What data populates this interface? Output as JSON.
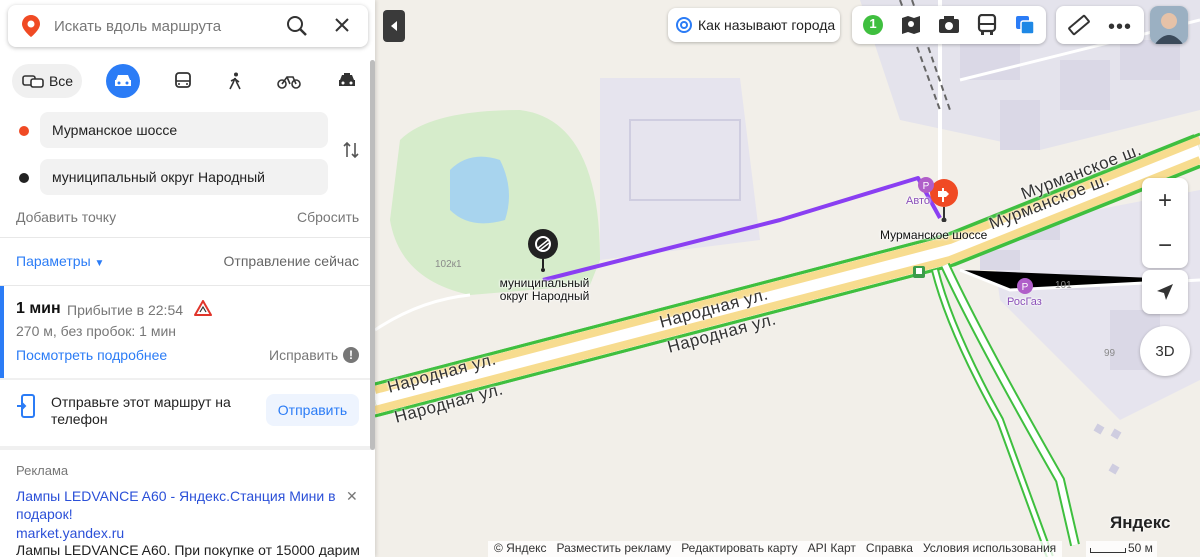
{
  "search": {
    "placeholder": "Искать вдоль маршрута"
  },
  "modes": {
    "all_label": "Все"
  },
  "route": {
    "from": "Мурманское шоссе",
    "to": "муниципальный округ Народный",
    "add_point": "Добавить точку",
    "reset": "Сбросить"
  },
  "params": {
    "label": "Параметры",
    "departure": "Отправление сейчас"
  },
  "route_card": {
    "time": "1 мин",
    "arrival": "Прибытие в 22:54",
    "distance": "270 м, без пробок: 1 мин",
    "details_link": "Посмотреть подробнее",
    "fix_link": "Исправить"
  },
  "send": {
    "text": "Отправьте этот маршрут на телефон",
    "button": "Отправить"
  },
  "ad": {
    "label": "Реклама",
    "title": "Лампы LEDVANCE A60 - Яндекс.Станция Мини в подарок!",
    "url": "market.yandex.ru",
    "text": "Лампы LEDVANCE A60. При покупке от 15000 дарим"
  },
  "top": {
    "city_button": "Как называют города",
    "traffic_level": "1",
    "threed": "3D"
  },
  "map": {
    "street_1": "Народная ул.",
    "street_2": "Народная ул.",
    "street_3": "Народная ул.",
    "street_4": "Народная ул.",
    "highway_1": "Мурманское ш.",
    "highway_2": "Мурманское ш.",
    "dest_label": "муниципальный округ Народный",
    "start_label": "Мурманское шоссе",
    "poi_avto": "Авто",
    "poi_rosgaz": "РосГаз",
    "house_102k1": "102к1",
    "house_101": "101",
    "house_99": "99"
  },
  "logo": "Яндекс",
  "footer": {
    "copyright": "© Яндекс",
    "ads": "Разместить рекламу",
    "edit": "Редактировать карту",
    "api": "API Карт",
    "help": "Справка",
    "terms": "Условия использования"
  },
  "scale": "50 м",
  "colors": {
    "accent": "#2b7cf6",
    "route": "#8a3ff2",
    "start_pin": "#f04a24",
    "road": "#f7dc8f",
    "traffic": "#3fbf3f"
  }
}
